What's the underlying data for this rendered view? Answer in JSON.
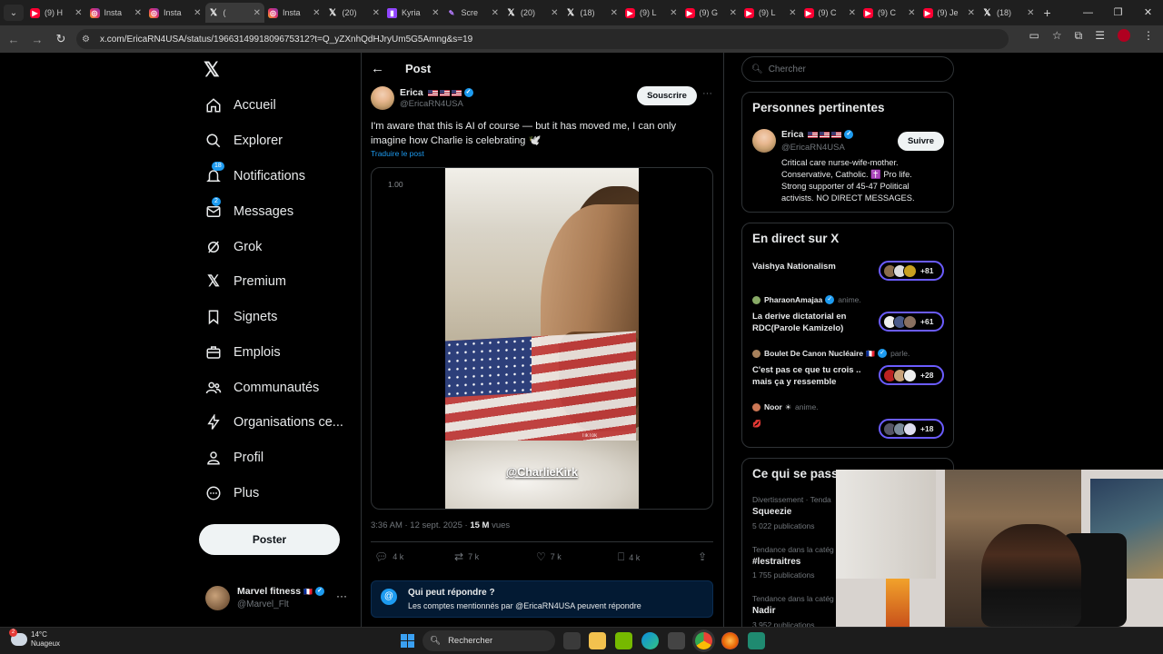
{
  "browser": {
    "tabs": [
      {
        "icon": "youtube-icon",
        "title": "(9) H"
      },
      {
        "icon": "instagram-icon",
        "title": "Insta"
      },
      {
        "icon": "instagram-icon",
        "title": "Insta"
      },
      {
        "icon": "x-icon",
        "title": "(",
        "active": true
      },
      {
        "icon": "instagram-icon",
        "title": "Insta"
      },
      {
        "icon": "x-icon",
        "title": "(20)"
      },
      {
        "icon": "twitch-icon",
        "title": "Kyria"
      },
      {
        "icon": "pen-icon",
        "title": "Scre"
      },
      {
        "icon": "x-icon",
        "title": "(20)"
      },
      {
        "icon": "x-icon",
        "title": "(18)"
      },
      {
        "icon": "youtube-icon",
        "title": "(9) L"
      },
      {
        "icon": "youtube-icon",
        "title": "(9) G"
      },
      {
        "icon": "youtube-icon",
        "title": "(9) L"
      },
      {
        "icon": "youtube-icon",
        "title": "(9) C"
      },
      {
        "icon": "youtube-icon",
        "title": "(9) C"
      },
      {
        "icon": "youtube-icon",
        "title": "(9) Je"
      },
      {
        "icon": "x-icon",
        "title": "(18)"
      }
    ],
    "url": "x.com/EricaRN4USA/status/1966314991809675312?t=Q_yZXnhQdHJryUm5G5Amng&s=19"
  },
  "nav": {
    "items": [
      {
        "id": "home",
        "label": "Accueil"
      },
      {
        "id": "explore",
        "label": "Explorer"
      },
      {
        "id": "notifications",
        "label": "Notifications",
        "badge": "18"
      },
      {
        "id": "messages",
        "label": "Messages",
        "badge": "2"
      },
      {
        "id": "grok",
        "label": "Grok"
      },
      {
        "id": "premium",
        "label": "Premium"
      },
      {
        "id": "bookmarks",
        "label": "Signets"
      },
      {
        "id": "jobs",
        "label": "Emplois"
      },
      {
        "id": "communities",
        "label": "Communautés"
      },
      {
        "id": "organizations",
        "label": "Organisations ce..."
      },
      {
        "id": "profile",
        "label": "Profil"
      },
      {
        "id": "more",
        "label": "Plus"
      }
    ],
    "post_button": "Poster",
    "account": {
      "name": "Marvel fitness",
      "handle": "@Marvel_Flt"
    }
  },
  "post": {
    "header": "Post",
    "author_name": "Erica",
    "author_handle": "@EricaRN4USA",
    "subscribe": "Souscrire",
    "text": "I'm aware that this is AI of course — but it has moved me, I can only imagine how Charlie is celebrating 🕊️",
    "translate": "Traduire le post",
    "media": {
      "speed": "1.00",
      "overlay": "@CharlieKirk",
      "tiktok": "TikTok"
    },
    "time": "3:36 AM · 12 sept. 2025 · ",
    "views_count": "15 M",
    "views_label": " vues",
    "stats": {
      "replies": "4 k",
      "reposts": "7 k",
      "likes": "7 k",
      "bookmarks": "4 k"
    },
    "reply_notice_title": "Qui peut répondre ?",
    "reply_notice_text": "Les comptes mentionnés par @EricaRN4USA peuvent répondre"
  },
  "search": {
    "placeholder": "Chercher"
  },
  "relevant": {
    "title": "Personnes pertinentes",
    "name": "Erica",
    "handle": "@EricaRN4USA",
    "follow": "Suivre",
    "bio": "Critical care nurse-wife-mother. Conservative, Catholic. ✝️ Pro life. Strong supporter of 45-47 Political activists. NO DIRECT MESSAGES."
  },
  "live": {
    "title": "En direct sur X",
    "spaces": [
      {
        "host": "",
        "role": "",
        "title": "Vaishya Nationalism",
        "count": "+81"
      },
      {
        "host": "PharaonAmajaa",
        "role": "anime.",
        "title": "La derive dictatorial en RDC(Parole Kamizelo)",
        "count": "+61"
      },
      {
        "host": "Boulet De Canon Nucléaire",
        "role": "parle.",
        "title": "C'est pas ce que tu crois .. mais ça y ressemble",
        "count": "+28"
      },
      {
        "host": "Noor",
        "role": "anime.",
        "title": "💋",
        "count": "+18"
      }
    ]
  },
  "trends": {
    "title": "Ce qui se pass",
    "items": [
      {
        "context": "Divertissement · Tenda",
        "name": "Squeezie",
        "count": "5 022 publications"
      },
      {
        "context": "Tendance dans la catég",
        "name": "#lestraitres",
        "count": "1 755 publications"
      },
      {
        "context": "Tendance dans la catég",
        "name": "Nadir",
        "count": "3 952 publications"
      }
    ]
  },
  "taskbar": {
    "temp": "14°C",
    "condition": "Nuageux",
    "search": "Rechercher",
    "weather_badge": "2"
  }
}
